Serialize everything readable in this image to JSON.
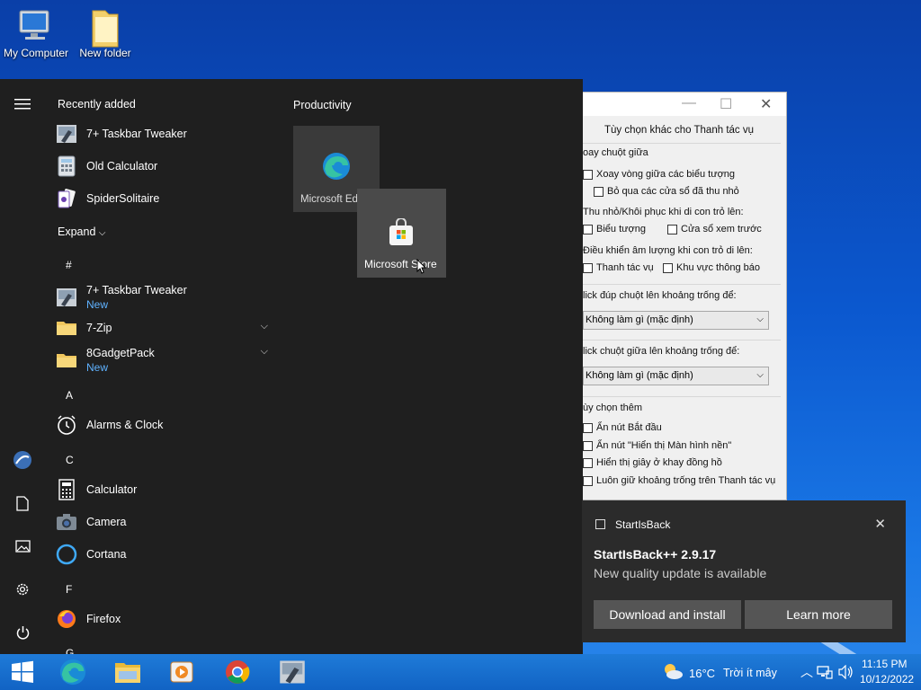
{
  "desktop": {
    "icons": [
      {
        "label": "My Computer",
        "icon": "computer-icon"
      },
      {
        "label": "New folder",
        "icon": "folder-icon"
      }
    ]
  },
  "dialog": {
    "title": "Tùy chọn khác cho Thanh tác vụ",
    "groups": {
      "middle_wheel": "oay chuột giữa",
      "min_restore": "Thu nhỏ/Khôi phục khi di con trỏ lên:",
      "volume": "Điều khiển âm lượng khi con trỏ di lên:",
      "dbl_click": "lick đúp chuột lên khoảng trống để:",
      "middle_click": "lick chuột giữa lên khoảng trống để:",
      "more": "ùy chọn thêm"
    },
    "options": {
      "cycle_icons": "Xoay vòng giữa các biểu tượng",
      "skip_minimized": "Bỏ qua các cửa sổ đã thu nhỏ",
      "icons": "Biểu tượng",
      "preview": "Cửa sổ xem trước",
      "taskbar": "Thanh tác vụ",
      "notify_area": "Khu vực thông báo",
      "hide_start": "Ẩn nút Bắt đầu",
      "hide_show_desktop": "Ẩn nút \"Hiển thị Màn hình nền\"",
      "show_seconds": "Hiển thị giây ở khay đồng hồ",
      "keep_space": "Luôn giữ khoảng trống trên Thanh tác vụ"
    },
    "select_dbl": "Không làm gì (mặc định)",
    "select_middle": "Không làm gì (mặc định)"
  },
  "start_menu": {
    "recently_added": "Recently added",
    "recent": [
      "7+ Taskbar Tweaker",
      "Old Calculator",
      "SpiderSolitaire"
    ],
    "expand": "Expand",
    "sections": [
      "#",
      "A",
      "C",
      "F",
      "G"
    ],
    "apps": [
      {
        "name": "7+ Taskbar Tweaker",
        "badge": "New"
      },
      {
        "name": "7-Zip"
      },
      {
        "name": "8GadgetPack",
        "badge": "New"
      },
      {
        "name": "Alarms & Clock"
      },
      {
        "name": "Calculator"
      },
      {
        "name": "Camera"
      },
      {
        "name": "Cortana"
      },
      {
        "name": "Firefox"
      }
    ],
    "tiles_group": "Productivity",
    "tiles": [
      "Microsoft Edge",
      "Microsoft Store"
    ]
  },
  "toast": {
    "app": "StartIsBack",
    "title": "StartIsBack++ 2.9.17",
    "body": "New quality update is available",
    "primary": "Download and install",
    "secondary": "Learn more"
  },
  "taskbar": {
    "weather_temp": "16°C",
    "weather_text": "Trời ít mây",
    "time": "11:15 PM",
    "date": "10/12/2022"
  },
  "colors": {
    "accent_blue": "#1f7bd8",
    "start_bg": "#1f1f1f",
    "new_badge": "#5fb2ff"
  }
}
